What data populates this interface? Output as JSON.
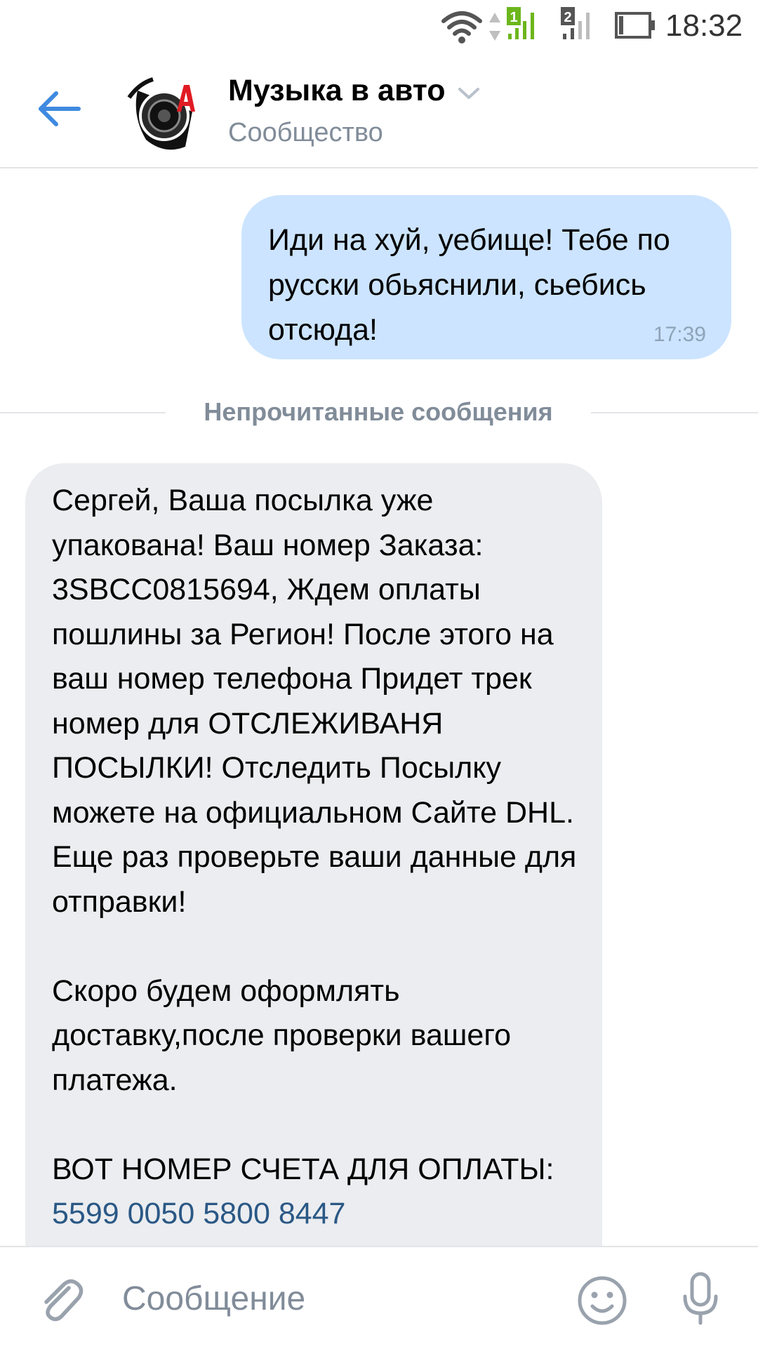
{
  "status_bar": {
    "time": "18:32",
    "sim1_label": "1",
    "sim2_label": "2"
  },
  "header": {
    "title": "Музыка в авто",
    "subtitle": "Сообщество"
  },
  "messages": {
    "outgoing": {
      "text": "Иди на хуй, уебище! Тебе по русски обьяснили, сьебись отсюда!",
      "time": "17:39"
    },
    "unread_divider": "Непрочитанные сообщения",
    "incoming": {
      "text": "Сергей, Ваша посылка уже упакована! Ваш номер Заказа: 3SBCC0815694, Ждем оплаты пошлины за Регион! После этого на ваш номер телефона Придет трек номер для ОТСЛЕЖИВАНЯ ПОСЫЛКИ! Отследить Посылку можете на официальном Сайте DHL. Еще раз проверьте ваши данные для отправки!\n\nСкоро будем оформлять доставку,после проверки вашего платежа.\n\nВОТ НОМЕР СЧЕТА ДЛЯ ОПЛАТЫ: ",
      "link": "5599 0050 5800 8447"
    }
  },
  "composer": {
    "placeholder": "Сообщение",
    "value": ""
  },
  "colors": {
    "accent": "#3f8ae0",
    "outgoing_bubble": "#cce4ff",
    "incoming_bubble": "#ebedf0",
    "secondary_text": "#818c99",
    "link": "#2a5885",
    "sim_active": "#6cb61c"
  },
  "icons": {
    "wifi": "wifi-icon",
    "data_arrows": "data-arrows-icon",
    "sim1_signal": "signal-icon",
    "sim2_signal": "signal-icon",
    "battery": "battery-icon",
    "back": "arrow-left-icon",
    "dropdown": "chevron-down-icon",
    "attach": "paperclip-icon",
    "emoji": "smiley-icon",
    "voice": "microphone-icon"
  }
}
